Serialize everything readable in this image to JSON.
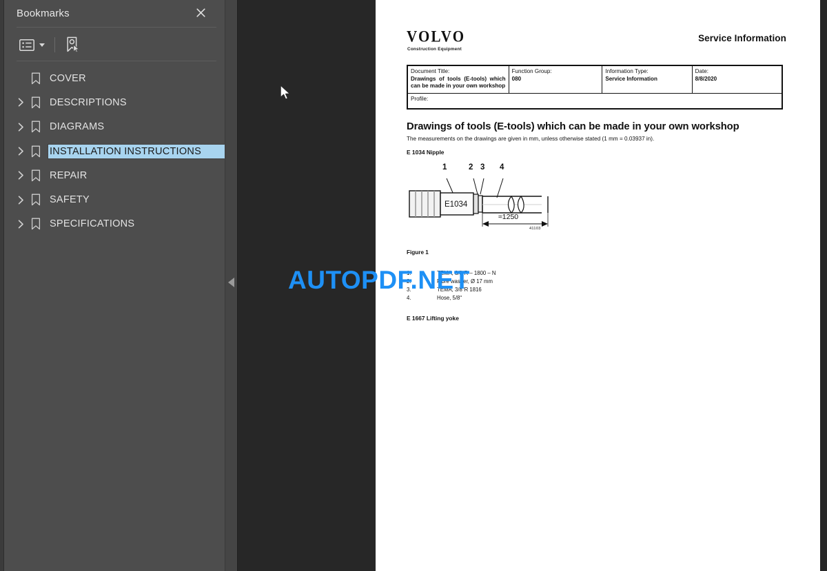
{
  "sidebar": {
    "title": "Bookmarks",
    "close_icon": "close-icon",
    "toolbar": {
      "options_icon": "list-options-icon",
      "caret_icon": "chevron-down-icon",
      "new_bookmark_icon": "new-bookmark-icon"
    },
    "items": [
      {
        "label": "COVER",
        "expandable": false,
        "selected": false
      },
      {
        "label": "DESCRIPTIONS",
        "expandable": true,
        "selected": false
      },
      {
        "label": "DIAGRAMS",
        "expandable": true,
        "selected": false
      },
      {
        "label": "INSTALLATION INSTRUCTIONS",
        "expandable": true,
        "selected": true
      },
      {
        "label": "REPAIR",
        "expandable": true,
        "selected": false
      },
      {
        "label": "SAFETY",
        "expandable": true,
        "selected": false
      },
      {
        "label": "SPECIFICATIONS",
        "expandable": true,
        "selected": false
      }
    ]
  },
  "splitter": {
    "collapse_icon": "collapse-left-icon"
  },
  "document": {
    "brand": "VOLVO",
    "brand_sub": "Construction Equipment",
    "header_right": "Service Information",
    "info_table": {
      "row1": [
        {
          "label": "Document Title:",
          "value": "Drawings of tools (E-tools) which can be made in your own workshop"
        },
        {
          "label": "Function Group:",
          "value": "080"
        },
        {
          "label": "Information Type:",
          "value": "Service Information"
        },
        {
          "label": "Date:",
          "value": "8/8/2020"
        }
      ],
      "row2": {
        "label": "Profile:",
        "value": ""
      }
    },
    "title": "Drawings of tools (E-tools) which can be made in your own workshop",
    "note": "The measurements on the drawings are given in mm, unless otherwise stated (1 mm = 0.03937 in).",
    "section_1": "E 1034 Nipple",
    "figure": {
      "callouts": [
        "1",
        "2",
        "3",
        "4"
      ],
      "body_label": "E1034",
      "dimension": "≈1250",
      "ref_number": "41103"
    },
    "figure_caption": "Figure 1",
    "parts": [
      {
        "num": "1.",
        "text": "TEMA, 3/8ʺR – 1800 – N"
      },
      {
        "num": "2.",
        "text": "Fibre washer, Ø 17 mm"
      },
      {
        "num": "3.",
        "text": "TEMA, 3/8ʺR 1816"
      },
      {
        "num": "4.",
        "text": "Hose, 5/8ʺ"
      }
    ],
    "section_2": "E 1667 Lifting yoke"
  },
  "watermark": "AUTOPDF.NET",
  "cursor": {
    "icon": "mouse-pointer-icon"
  },
  "colors": {
    "sidebar_bg": "#4d4d4d",
    "viewer_bg": "#272727",
    "splitter_bg": "#454545",
    "selection": "#a8d4ef",
    "watermark": "#1e90f5",
    "page_bg": "#ffffff"
  }
}
